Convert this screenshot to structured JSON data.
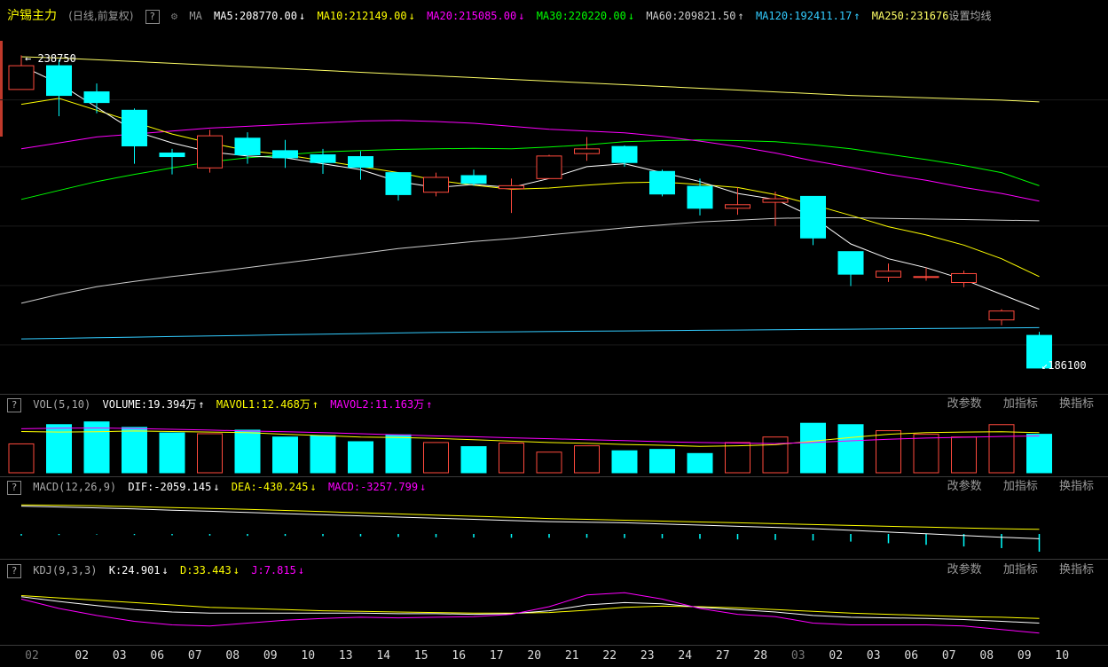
{
  "colors": {
    "up": "#ff4a3d",
    "down": "#00ffff",
    "ma5": "#ffffff",
    "ma10": "#ffff00",
    "ma20": "#ff00ff",
    "ma30": "#00ff00",
    "ma60": "#cccccc",
    "ma120": "#33ccff",
    "ma250": "#ffff66"
  },
  "header": {
    "title": "沪锡主力",
    "subtitle": "(日线,前复权)",
    "help": "?",
    "settings_icon": "gear-icon",
    "ma_label": "MA",
    "ma5": "MA5:208770.00",
    "ma5_arrow": "↓",
    "ma10": "MA10:212149.00",
    "ma10_arrow": "↓",
    "ma20": "MA20:215085.00",
    "ma20_arrow": "↓",
    "ma30": "MA30:220220.00",
    "ma30_arrow": "↓",
    "ma60": "MA60:209821.50",
    "ma60_arrow": "↑",
    "ma120": "MA120:192411.17",
    "ma120_arrow": "↑",
    "ma250": "MA250:231676",
    "set_ma": "设置均线"
  },
  "price_labels": {
    "high": "238750",
    "low": "186100"
  },
  "vol": {
    "help": "?",
    "label": "VOL(5,10)",
    "volume": "VOLUME:19.394万",
    "volume_arrow": "↑",
    "mavol1": "MAVOL1:12.468万",
    "mavol1_arrow": "↑",
    "mavol2": "MAVOL2:11.163万",
    "mavol2_arrow": "↑"
  },
  "macd": {
    "help": "?",
    "label": "MACD(12,26,9)",
    "dif": "DIF:-2059.145",
    "dif_arrow": "↓",
    "dea": "DEA:-430.245",
    "dea_arrow": "↓",
    "macd": "MACD:-3257.799",
    "macd_arrow": "↓"
  },
  "kdj": {
    "help": "?",
    "label": "KDJ(9,3,3)",
    "k": "K:24.901",
    "k_arrow": "↓",
    "d": "D:33.443",
    "d_arrow": "↓",
    "j": "J:7.815",
    "j_arrow": "↓"
  },
  "panel_actions": {
    "params": "改参数",
    "add": "加指标",
    "switch": "换指标"
  },
  "dates": [
    "02",
    "02",
    "03",
    "06",
    "07",
    "08",
    "09",
    "10",
    "13",
    "14",
    "15",
    "16",
    "17",
    "20",
    "21",
    "22",
    "23",
    "24",
    "27",
    "28",
    "03",
    "02",
    "03",
    "06",
    "07",
    "08",
    "09",
    "10"
  ],
  "chart_data": {
    "type": "candlestick",
    "price_range": [
      184000,
      240000
    ],
    "candles": [
      {
        "o": 233000,
        "c": 237000,
        "h": 238750,
        "l": 233000
      },
      {
        "o": 237000,
        "c": 232000,
        "h": 238000,
        "l": 228500
      },
      {
        "o": 232600,
        "c": 230800,
        "h": 234000,
        "l": 229000
      },
      {
        "o": 229500,
        "c": 223500,
        "h": 229800,
        "l": 220500
      },
      {
        "o": 222300,
        "c": 221700,
        "h": 223000,
        "l": 218700
      },
      {
        "o": 219800,
        "c": 225200,
        "h": 226200,
        "l": 219000
      },
      {
        "o": 224800,
        "c": 222000,
        "h": 225800,
        "l": 220500
      },
      {
        "o": 222700,
        "c": 221500,
        "h": 224500,
        "l": 219800
      },
      {
        "o": 222000,
        "c": 220700,
        "h": 223000,
        "l": 218800
      },
      {
        "o": 221700,
        "c": 219900,
        "h": 222600,
        "l": 217800
      },
      {
        "o": 219000,
        "c": 215300,
        "h": 219000,
        "l": 214300
      },
      {
        "o": 215700,
        "c": 218200,
        "h": 219000,
        "l": 215000
      },
      {
        "o": 218500,
        "c": 217200,
        "h": 219500,
        "l": 216800
      },
      {
        "o": 216300,
        "c": 216800,
        "h": 218000,
        "l": 212200
      },
      {
        "o": 218000,
        "c": 221800,
        "h": 222000,
        "l": 218000
      },
      {
        "o": 222200,
        "c": 223000,
        "h": 225000,
        "l": 221000
      },
      {
        "o": 223400,
        "c": 220700,
        "h": 223600,
        "l": 220000
      },
      {
        "o": 219200,
        "c": 215400,
        "h": 219500,
        "l": 215000
      },
      {
        "o": 216700,
        "c": 213000,
        "h": 218000,
        "l": 211800
      },
      {
        "o": 213000,
        "c": 213600,
        "h": 216500,
        "l": 211900
      },
      {
        "o": 214000,
        "c": 214600,
        "h": 215800,
        "l": 210000
      },
      {
        "o": 215000,
        "c": 208000,
        "h": 215000,
        "l": 206800
      },
      {
        "o": 205700,
        "c": 201900,
        "h": 205700,
        "l": 199900
      },
      {
        "o": 201400,
        "c": 202400,
        "h": 203700,
        "l": 200600
      },
      {
        "o": 201500,
        "c": 201500,
        "h": 203000,
        "l": 200800
      },
      {
        "o": 200500,
        "c": 202000,
        "h": 202500,
        "l": 199700
      },
      {
        "o": 194200,
        "c": 195700,
        "h": 196000,
        "l": 193300
      },
      {
        "o": 191600,
        "c": 186100,
        "h": 192200,
        "l": 186100
      }
    ],
    "ma": {
      "ma5": [
        237000,
        234000,
        230000,
        226000,
        224000,
        222500,
        221800,
        221500,
        220500,
        219500,
        217500,
        216500,
        217000,
        216500,
        218000,
        220000,
        220500,
        219000,
        217500,
        215500,
        214500,
        211500,
        207000,
        204500,
        203000,
        201000,
        198500,
        196000
      ],
      "ma10": [
        230500,
        231500,
        229500,
        227500,
        225500,
        224000,
        222700,
        222000,
        221000,
        220000,
        219000,
        217700,
        216900,
        216200,
        216400,
        216900,
        217300,
        217400,
        217000,
        216500,
        215300,
        213600,
        211800,
        209900,
        208500,
        206800,
        204500,
        201500
      ],
      "ma20": [
        223000,
        224000,
        225000,
        225500,
        226000,
        226500,
        226800,
        227100,
        227400,
        227700,
        227800,
        227600,
        227300,
        226800,
        226300,
        226000,
        225700,
        225100,
        224300,
        223400,
        222300,
        221000,
        219900,
        218700,
        217700,
        216500,
        215500,
        214200
      ],
      "ma30": [
        214500,
        216000,
        217500,
        218700,
        219800,
        220800,
        221500,
        222000,
        222500,
        222700,
        222900,
        223000,
        223100,
        223000,
        223300,
        223700,
        224200,
        224400,
        224500,
        224400,
        224200,
        223700,
        223000,
        222100,
        221200,
        220200,
        219000,
        216800
      ],
      "ma60": [
        197000,
        198500,
        199800,
        200700,
        201500,
        202200,
        203000,
        203800,
        204600,
        205400,
        206200,
        206800,
        207400,
        207900,
        208500,
        209100,
        209700,
        210200,
        210700,
        211000,
        211300,
        211400,
        211400,
        211300,
        211200,
        211100,
        211000,
        210900
      ],
      "ma120": [
        191000,
        191100,
        191200,
        191300,
        191400,
        191500,
        191600,
        191700,
        191800,
        191900,
        192000,
        192100,
        192150,
        192200,
        192250,
        192300,
        192350,
        192400,
        192450,
        192500,
        192550,
        192600,
        192650,
        192700,
        192750,
        192800,
        192850,
        192900
      ],
      "ma250": [
        238500,
        238300,
        238000,
        237700,
        237400,
        237100,
        236800,
        236500,
        236200,
        235900,
        235600,
        235300,
        235000,
        234700,
        234400,
        234100,
        233800,
        233500,
        233200,
        232900,
        232600,
        232300,
        232000,
        231800,
        231600,
        231400,
        231200,
        230900
      ]
    },
    "volume": [
      10.5,
      17.5,
      18.5,
      16.5,
      14.5,
      14.2,
      15.5,
      13.0,
      13.5,
      11.3,
      13.8,
      11.0,
      9.5,
      10.8,
      7.5,
      9.8,
      8.0,
      8.5,
      7.0,
      11.0,
      13.0,
      18.0,
      17.5,
      15.3,
      14.0,
      13.0,
      17.5,
      14.0
    ],
    "mavol1": [
      15.0,
      14.8,
      14.9,
      15.2,
      15.0,
      14.8,
      14.6,
      14.0,
      13.5,
      13.0,
      12.8,
      12.5,
      12.0,
      11.5,
      11.0,
      10.7,
      10.3,
      10.0,
      9.6,
      9.8,
      10.2,
      11.5,
      12.8,
      14.0,
      14.6,
      14.8,
      14.9,
      14.6
    ],
    "mavol2": [
      16.0,
      16.2,
      16.3,
      16.1,
      15.8,
      15.5,
      15.2,
      14.9,
      14.6,
      14.2,
      13.8,
      13.4,
      13.1,
      12.7,
      12.4,
      12.0,
      11.7,
      11.3,
      11.0,
      10.8,
      10.6,
      11.0,
      11.6,
      12.2,
      12.6,
      12.9,
      13.2,
      13.4
    ],
    "macd_dif": [
      3600,
      3450,
      3300,
      3100,
      2900,
      2700,
      2500,
      2300,
      2100,
      1900,
      1700,
      1500,
      1300,
      1100,
      900,
      800,
      700,
      500,
      300,
      100,
      -100,
      -300,
      -600,
      -900,
      -1200,
      -1500,
      -1800,
      -2059
    ],
    "macd_dea": [
      3800,
      3750,
      3650,
      3500,
      3350,
      3200,
      3050,
      2850,
      2650,
      2450,
      2250,
      2050,
      1850,
      1650,
      1450,
      1300,
      1150,
      1000,
      850,
      700,
      550,
      400,
      250,
      100,
      -50,
      -200,
      -320,
      -430
    ],
    "macd_hist": [
      -300,
      -200,
      -100,
      -200,
      -250,
      -300,
      -350,
      -350,
      -400,
      -450,
      -550,
      -600,
      -650,
      -700,
      -700,
      -700,
      -750,
      -800,
      -900,
      -1000,
      -1100,
      -1200,
      -1400,
      -1700,
      -2000,
      -2300,
      -2600,
      -3258
    ],
    "kdj_k": [
      70,
      62,
      55,
      48,
      44,
      42,
      42,
      42,
      42,
      42,
      41,
      41,
      40,
      41,
      46,
      56,
      60,
      58,
      52,
      48,
      44,
      38,
      35,
      34,
      33,
      31,
      28,
      25
    ],
    "kdj_d": [
      72,
      68,
      64,
      60,
      56,
      52,
      50,
      48,
      46,
      45,
      44,
      43,
      42,
      42,
      43,
      47,
      52,
      54,
      53,
      51,
      48,
      45,
      42,
      40,
      38,
      36,
      35,
      33
    ],
    "kdj_j": [
      66,
      50,
      38,
      28,
      22,
      20,
      25,
      30,
      33,
      35,
      34,
      35,
      36,
      40,
      53,
      73,
      77,
      66,
      50,
      40,
      36,
      25,
      22,
      22,
      22,
      20,
      14,
      8
    ]
  }
}
